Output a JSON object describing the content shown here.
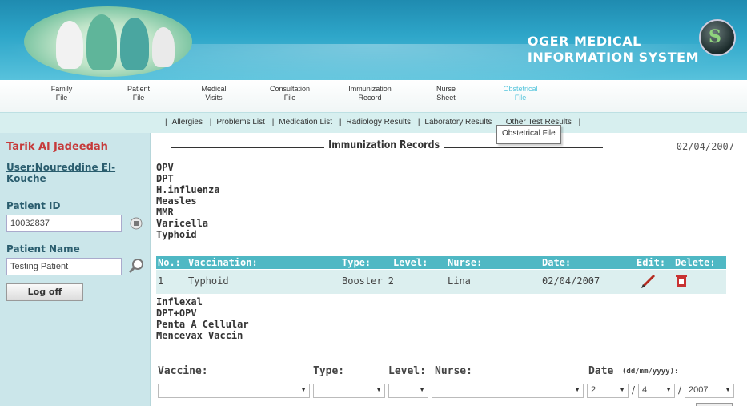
{
  "header": {
    "logo_line1": "OGER MEDICAL",
    "logo_line2": "INFORMATION SYSTEM",
    "logo_mark": "S",
    "photo": "medical-staff-photo"
  },
  "tabs": [
    {
      "line1": "Family",
      "line2": "File"
    },
    {
      "line1": "Patient",
      "line2": "File"
    },
    {
      "line1": "Medical",
      "line2": "Visits"
    },
    {
      "line1": "Consultation",
      "line2": "File"
    },
    {
      "line1": "Immunization",
      "line2": "Record"
    },
    {
      "line1": "Nurse",
      "line2": "Sheet"
    },
    {
      "line1": "Obstetrical",
      "line2": "File"
    }
  ],
  "sublinks": [
    "Allergies",
    "Problems List",
    "Medication List",
    "Radiology Results",
    "Laboratory Results",
    "Other Test Results"
  ],
  "tooltip": "Obstetrical File",
  "left": {
    "patient_name_header": "Tarik Al Jadeedah",
    "user_label": "User:Noureddine El-Kouche",
    "patient_id_label": "Patient ID",
    "patient_id_value": "10032837",
    "patient_name_label": "Patient Name",
    "patient_name_value": "Testing Patient",
    "logoff": "Log off"
  },
  "main": {
    "title": "Immunization Records",
    "date": "02/04/2007",
    "vaccines_top": [
      "OPV",
      "DPT",
      "H.influenza",
      "Measles",
      "MMR",
      "Varicella",
      "Typhoid"
    ],
    "table": {
      "headers": [
        "No.:",
        "Vaccination:",
        "Type:",
        "Level:",
        "Nurse:",
        "Date:",
        "Edit:",
        "Delete:"
      ],
      "rows": [
        {
          "no": "1",
          "vaccination": "Typhoid",
          "type": "Booster 2",
          "level": "",
          "nurse": "Lina",
          "date": "02/04/2007"
        }
      ]
    },
    "vaccines_bottom": [
      "Inflexal",
      "DPT+OPV",
      "Penta A Cellular",
      "Mencevax Vaccin"
    ],
    "form": {
      "vaccine_label": "Vaccine:",
      "type_label": "Type:",
      "level_label": "Level:",
      "nurse_label": "Nurse:",
      "date_label": "Date",
      "date_format": "(dd/mm/yyyy):",
      "day": "2",
      "month": "4",
      "year": "2007",
      "slash1": "/",
      "slash2": "/"
    }
  },
  "colors": {
    "banner": "#2ea6c9",
    "table_header": "#4fb8c4",
    "table_row": "#dcefef",
    "left_panel": "#cbe6ea",
    "patient_name": "#c63a3a",
    "active_tab": "#55c5dc"
  }
}
